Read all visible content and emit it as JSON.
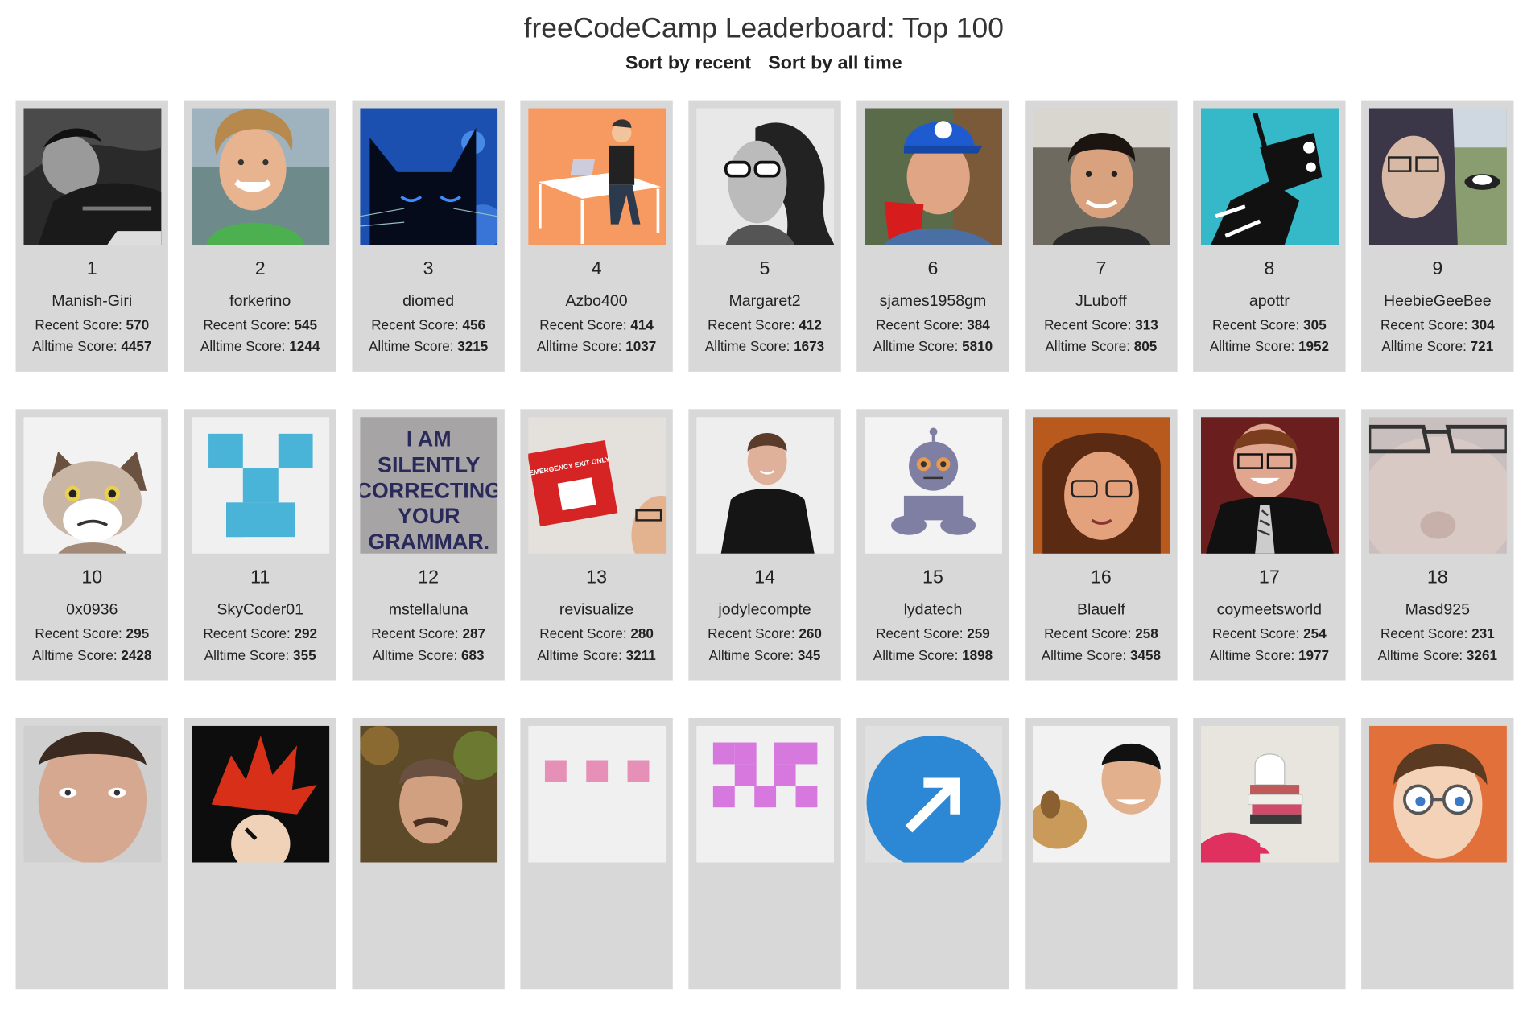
{
  "header": {
    "title": "freeCodeCamp Leaderboard: Top 100",
    "sort_recent": "Sort by recent",
    "sort_alltime": "Sort by all time"
  },
  "labels": {
    "recent": "Recent Score:",
    "alltime": "Alltime Score:"
  },
  "users": [
    {
      "rank": "1",
      "name": "Manish-Giri",
      "recent": "570",
      "alltime": "4457",
      "avatar": "bw-man-lying"
    },
    {
      "rank": "2",
      "name": "forkerino",
      "recent": "545",
      "alltime": "1244",
      "avatar": "smiling-curly-hair"
    },
    {
      "rank": "3",
      "name": "diomed",
      "recent": "456",
      "alltime": "3215",
      "avatar": "black-cat-blue"
    },
    {
      "rank": "4",
      "name": "Azbo400",
      "recent": "414",
      "alltime": "1037",
      "avatar": "man-at-desk-orange"
    },
    {
      "rank": "5",
      "name": "Margaret2",
      "recent": "412",
      "alltime": "1673",
      "avatar": "woman-sunglasses-bw"
    },
    {
      "rank": "6",
      "name": "sjames1958gm",
      "recent": "384",
      "alltime": "5810",
      "avatar": "man-blue-cap-red-cup"
    },
    {
      "rank": "7",
      "name": "JLuboff",
      "recent": "313",
      "alltime": "805",
      "avatar": "man-car-selfie"
    },
    {
      "rank": "8",
      "name": "apottr",
      "recent": "305",
      "alltime": "1952",
      "avatar": "robot-teal"
    },
    {
      "rank": "9",
      "name": "HeebieGeeBee",
      "recent": "304",
      "alltime": "721",
      "avatar": "man-hoodie-glasses"
    },
    {
      "rank": "10",
      "name": "0x0936",
      "recent": "295",
      "alltime": "2428",
      "avatar": "grumpy-cat"
    },
    {
      "rank": "11",
      "name": "SkyCoder01",
      "recent": "292",
      "alltime": "355",
      "avatar": "blue-pixel-identicon"
    },
    {
      "rank": "12",
      "name": "mstellaluna",
      "recent": "287",
      "alltime": "683",
      "avatar": "grammar-shirt",
      "avatar_text": "I AM SILENTLY CORRECTING YOUR GRAMMAR."
    },
    {
      "rank": "13",
      "name": "revisualize",
      "recent": "280",
      "alltime": "3211",
      "avatar": "emergency-exit-sign",
      "avatar_text": "EMERGENCY EXIT ONLY"
    },
    {
      "rank": "14",
      "name": "jodylecompte",
      "recent": "260",
      "alltime": "345",
      "avatar": "man-black-shirt"
    },
    {
      "rank": "15",
      "name": "lydatech",
      "recent": "259",
      "alltime": "1898",
      "avatar": "robot-doll"
    },
    {
      "rank": "16",
      "name": "Blauelf",
      "recent": "258",
      "alltime": "3458",
      "avatar": "man-long-hair-orange"
    },
    {
      "rank": "17",
      "name": "coymeetsworld",
      "recent": "254",
      "alltime": "1977",
      "avatar": "man-glasses-tie"
    },
    {
      "rank": "18",
      "name": "Masd925",
      "recent": "231",
      "alltime": "3261",
      "avatar": "closeup-glasses"
    },
    {
      "avatar": "man-closeup"
    },
    {
      "avatar": "red-spiky-hair"
    },
    {
      "avatar": "man-mustache-forest"
    },
    {
      "avatar": "pink-pixel-identicon"
    },
    {
      "avatar": "magenta-pixel-identicon"
    },
    {
      "avatar": "blue-arrow-logo"
    },
    {
      "avatar": "man-with-dog"
    },
    {
      "avatar": "books-teapot"
    },
    {
      "avatar": "cartoon-man-glasses"
    }
  ]
}
